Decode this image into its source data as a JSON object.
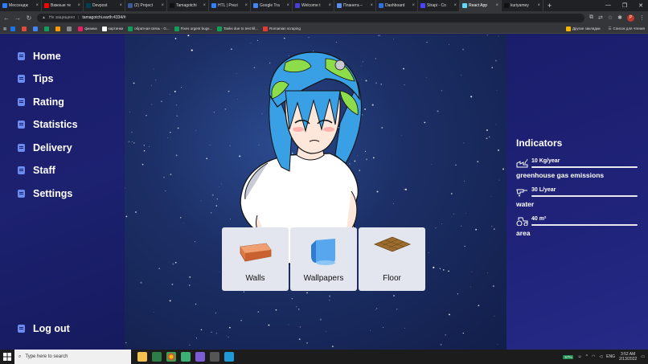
{
  "browser": {
    "tabs": [
      {
        "title": "Мессендж",
        "color": "#2b7cff"
      },
      {
        "title": "Важные те",
        "color": "#ff0000"
      },
      {
        "title": "Devpost",
        "color": "#003e54"
      },
      {
        "title": "(2) Project",
        "color": "#3b5998"
      },
      {
        "title": "Tamagotchi",
        "color": "#111111"
      },
      {
        "title": "HTL | Prezi",
        "color": "#3181ff"
      },
      {
        "title": "Google Tra",
        "color": "#4285f4"
      },
      {
        "title": "Welcome t",
        "color": "#4a3cdb"
      },
      {
        "title": "Планета –",
        "color": "#5b8def"
      },
      {
        "title": "Dashboard",
        "color": "#2d6fdf"
      },
      {
        "title": "Strapi - Co",
        "color": "#4945ff"
      },
      {
        "title": "React App",
        "color": "#61dafb",
        "active": true
      },
      {
        "title": "kuriyamey",
        "color": "#111111"
      }
    ],
    "new_tab": "+",
    "address": {
      "insecure_label": "Не защищено",
      "url": "tamagotchi.earth:4334/#"
    },
    "bookmarks": [
      {
        "title": "",
        "color": "#1a73e8"
      },
      {
        "title": "",
        "color": "#dd4b39"
      },
      {
        "title": "",
        "color": "#4285f4"
      },
      {
        "title": "",
        "color": "#0f9d58"
      },
      {
        "title": "",
        "color": "#ff9900"
      },
      {
        "title": "",
        "color": "#888888"
      },
      {
        "title": "физика",
        "color": "#e91e63"
      },
      {
        "title": "картинки",
        "color": "#ffffff"
      },
      {
        "title": "обратная связь - G...",
        "color": "#0f9d58"
      },
      {
        "title": "Fixes urgent bugs...",
        "color": "#0f9d58"
      },
      {
        "title": "Tasks due to test till...",
        "color": "#0f9d58"
      },
      {
        "title": "Romanian scraping",
        "color": "#e53935"
      }
    ],
    "other_bookmarks": "Другие закладки",
    "reading_list": "Список для чтения"
  },
  "sidebar": {
    "items": [
      {
        "label": "Home"
      },
      {
        "label": "Tips"
      },
      {
        "label": "Rating"
      },
      {
        "label": "Statistics"
      },
      {
        "label": "Delivery"
      },
      {
        "label": "Staff"
      },
      {
        "label": "Settings"
      }
    ],
    "logout": "Log out"
  },
  "indicators": {
    "title": "Indicators",
    "items": [
      {
        "value": "10 Kg/year",
        "label": "greenhouse gas emissions",
        "icon": "factory-icon"
      },
      {
        "value": "30 L/year",
        "label": "water",
        "icon": "faucet-icon"
      },
      {
        "value": "40 m²",
        "label": "area",
        "icon": "tractor-icon"
      }
    ]
  },
  "shop": {
    "items": [
      {
        "label": "Walls",
        "icon": "brick-icon"
      },
      {
        "label": "Wallpapers",
        "icon": "wallpaper-roll-icon"
      },
      {
        "label": "Floor",
        "icon": "parquet-icon"
      }
    ]
  },
  "taskbar": {
    "search_placeholder": "Type here to search",
    "battery": "57%",
    "language": "ENG",
    "time": "3:52 AM",
    "date": "2/13/2022"
  },
  "colors": {
    "sidebar_bg": "#1a1d6a",
    "nav_icon": "#6a8cf0",
    "card_bg": "#e3e6ee"
  }
}
